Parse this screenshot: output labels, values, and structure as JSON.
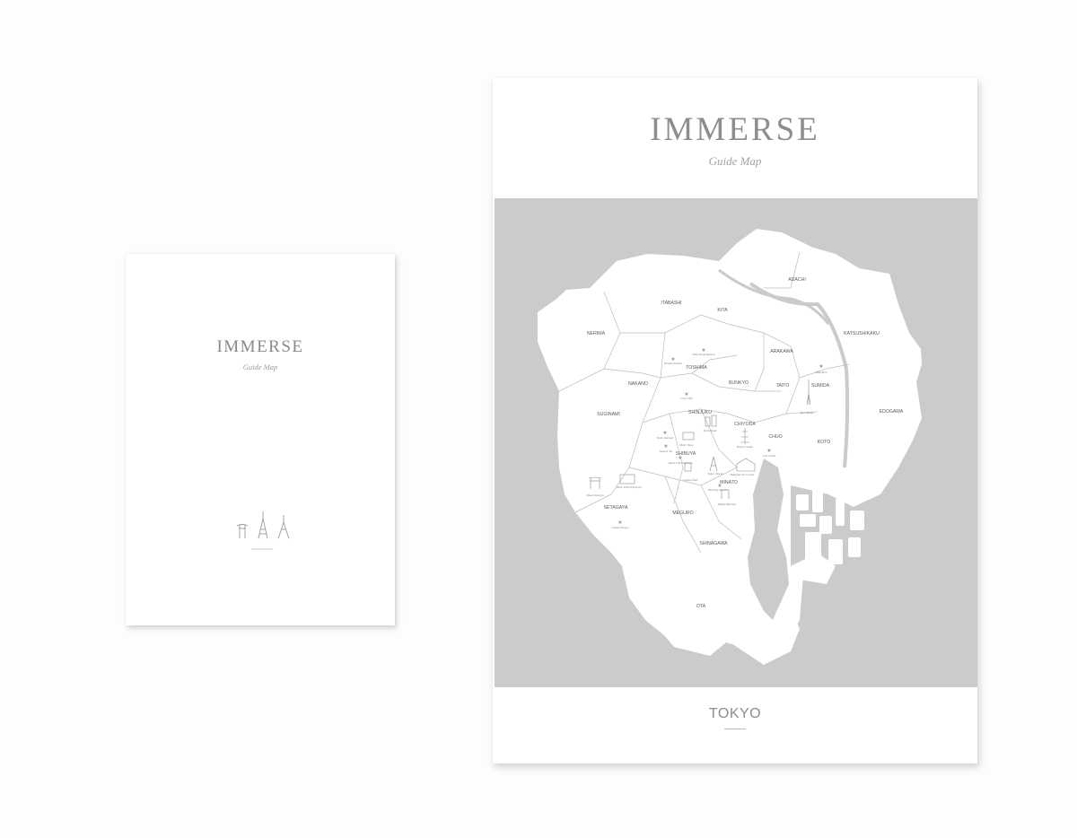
{
  "small_card": {
    "title": "IMMERSE",
    "subtitle": "Guide Map",
    "icons": [
      "torii-gate-icon",
      "tokyo-tower-icon",
      "skytree-icon"
    ]
  },
  "large_card": {
    "title": "IMMERSE",
    "subtitle": "Guide Map",
    "footer_label": "TOKYO",
    "map": {
      "background_color": "#cbcbcb",
      "land_color": "#ffffff",
      "wards": {
        "adachi": "ADACHI",
        "itabashi": "ITABASHI",
        "kita": "KITA",
        "nerima": "NERIMA",
        "katsushika": "KATSUSHIKAKU",
        "arakawa": "ARAKAWA",
        "toshima": "TOSHIMA",
        "nakano": "NAKANO",
        "bunkyo": "BUNKYO",
        "taito": "TAITO",
        "sumida": "SUMIDA",
        "edogawa": "EDOGAWA",
        "suginami": "SUGINAMI",
        "shinjuku": "SHINJUKU",
        "chiyoda": "CHIYODA",
        "chuo": "CHUO",
        "koto": "KOTO",
        "shibuya": "SHIBUYA",
        "minato": "MINATO",
        "setagaya": "SETAGAYA",
        "meguro": "MEGURO",
        "shinagawa": "SHINAGAWA",
        "ota": "OTA"
      },
      "spots": {
        "kong_kong": "King Kong Ramen",
        "bunkin": "Bunkin Salumi",
        "haneda": "Hanekiyo",
        "usui": "Usui Cafe",
        "sky": "Skyt Skyine",
        "park": "Park Hyatt",
        "sushi": "Sushi Zanmai",
        "meiji": "Meiji Jingu",
        "kokyo": "Kokyo Gaien",
        "chuo_spot": "Chu Ginza",
        "sakura": "Sakura Tei",
        "tokyo_tower": "Tokyo Tower",
        "national_art": "National Art Center",
        "gotoku": "Gotoku Hall",
        "blue_bottle": "Bowling Ramen",
        "todoroki": "Tonai Kinoeya",
        "bear_pond": "Bear Pond Espresso",
        "gyoza": "Gunge Ziogen",
        "shrine": "Atara Life Espresso",
        "minato_spot": "Hama Marsan"
      }
    }
  }
}
